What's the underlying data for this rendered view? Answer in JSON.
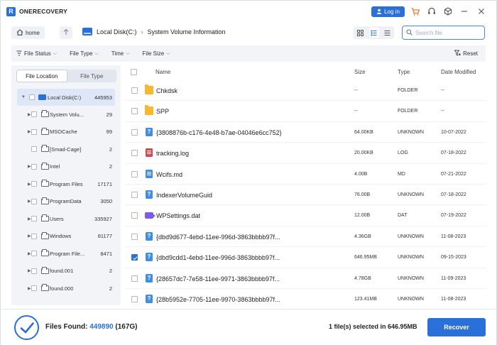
{
  "app": {
    "name": "ONERECOVERY",
    "logo_letter": "R",
    "login_label": "Log in"
  },
  "colors": {
    "accent": "#2b6fd8",
    "folder": "#f6b830",
    "log": "#e8404a",
    "dat": "#7b5bea"
  },
  "nav": {
    "home_label": "home",
    "breadcrumb": [
      "Local Disk(C:)",
      "System Volume Information"
    ],
    "search_placeholder": "Search file",
    "active_view": "list"
  },
  "filters": {
    "items": [
      "File Status",
      "File Type",
      "Time",
      "File Size"
    ],
    "reset_label": "Reset"
  },
  "left_panel": {
    "tabs": [
      "File Location",
      "File Type"
    ],
    "active_tab": "File Location",
    "tree": [
      {
        "name": "Local Disk(C:)",
        "count": "445953",
        "level": 0,
        "icon": "drive-icon",
        "expand": "down",
        "selected": true
      },
      {
        "name": "System Volu...",
        "count": "29",
        "level": 1,
        "icon": "folder-icon",
        "expand": "right"
      },
      {
        "name": "MSOCache",
        "count": "99",
        "level": 1,
        "icon": "folder-icon",
        "expand": "right"
      },
      {
        "name": "[Smad-Cage]",
        "count": "2",
        "level": 1,
        "icon": "folder-icon",
        "expand": "none"
      },
      {
        "name": "Intel",
        "count": "2",
        "level": 1,
        "icon": "folder-icon",
        "expand": "right"
      },
      {
        "name": "Program Files",
        "count": "17171",
        "level": 1,
        "icon": "folder-icon",
        "expand": "right"
      },
      {
        "name": "ProgramData",
        "count": "3050",
        "level": 1,
        "icon": "folder-icon",
        "expand": "right"
      },
      {
        "name": "Users",
        "count": "335927",
        "level": 1,
        "icon": "folder-icon",
        "expand": "right"
      },
      {
        "name": "Windows",
        "count": "81177",
        "level": 1,
        "icon": "folder-icon",
        "expand": "right"
      },
      {
        "name": "Program File...",
        "count": "8471",
        "level": 1,
        "icon": "folder-icon",
        "expand": "right"
      },
      {
        "name": "found.001",
        "count": "2",
        "level": 1,
        "icon": "folder-icon",
        "expand": "right"
      },
      {
        "name": "found.000",
        "count": "2",
        "level": 1,
        "icon": "folder-icon",
        "expand": "right"
      }
    ]
  },
  "table": {
    "columns": [
      "Name",
      "Size",
      "Type",
      "Date Modified"
    ],
    "rows": [
      {
        "name": "Chkdsk",
        "size": "--",
        "type": "FOLDER",
        "date": "--",
        "icon": "folder",
        "checked": false
      },
      {
        "name": "SPP",
        "size": "--",
        "type": "FOLDER",
        "date": "--",
        "icon": "folder",
        "checked": false
      },
      {
        "name": "{3808876b-c176-4e48-b7ae-04046e6cc752}",
        "size": "64.00KB",
        "type": "UNKNOWN",
        "date": "10-07-2022",
        "icon": "doc",
        "checked": false
      },
      {
        "name": "tracking.log",
        "size": "20.00KB",
        "type": "LOG",
        "date": "07-18-2022",
        "icon": "log",
        "checked": false
      },
      {
        "name": "Wcifs.md",
        "size": "4.00B",
        "type": "MD",
        "date": "07-21-2022",
        "icon": "md",
        "checked": false
      },
      {
        "name": "IndexerVolumeGuid",
        "size": "76.00B",
        "type": "UNKNOWN",
        "date": "07-18-2022",
        "icon": "doc",
        "checked": false
      },
      {
        "name": "WPSettings.dat",
        "size": "12.00B",
        "type": "DAT",
        "date": "07-19-2022",
        "icon": "dat",
        "checked": false
      },
      {
        "name": "{dbd9d677-4ebd-11ee-996d-3863bbbb97f...",
        "size": "4.36GB",
        "type": "UNKNOWN",
        "date": "11-08-2023",
        "icon": "doc",
        "checked": false
      },
      {
        "name": "{dbd9cdd1-4ebd-11ee-996d-3863bbbb97f...",
        "size": "646.95MB",
        "type": "UNKNOWN",
        "date": "09-15-2023",
        "icon": "doc",
        "checked": true
      },
      {
        "name": "{28657dc7-7e58-11ee-9971-3863bbbb97f...",
        "size": "4.78GB",
        "type": "UNKNOWN",
        "date": "11-09-2023",
        "icon": "doc",
        "checked": false
      },
      {
        "name": "{28b5952e-7705-11ee-9970-3863bbbb97f...",
        "size": "123.41MB",
        "type": "UNKNOWN",
        "date": "11-08-2023",
        "icon": "doc",
        "checked": false
      }
    ]
  },
  "footer": {
    "found_label": "Files Found:",
    "found_count": "449890",
    "found_size": "(167G)",
    "selection_text": "1 file(s) selected in 646.95MB",
    "recover_label": "Recover"
  }
}
